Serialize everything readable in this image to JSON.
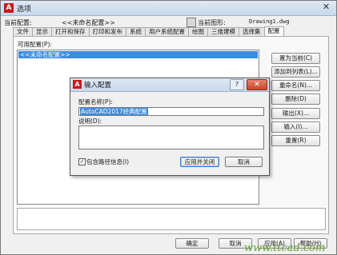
{
  "window": {
    "title": "选项",
    "app_icon": "A",
    "close": "✕"
  },
  "profile_row": {
    "current_profile_label": "当前配置:",
    "current_profile_value": "<<未命名配置>>",
    "current_drawing_label": "当前图形:",
    "current_drawing_value": "Drawing1.dwg"
  },
  "tabs": [
    "文件",
    "显示",
    "打开和保存",
    "打印和发布",
    "系统",
    "用户系统配置",
    "绘图",
    "三维建模",
    "选择集",
    "配置"
  ],
  "active_tab": "配置",
  "profiles": {
    "label": "可用配置(P):",
    "items": [
      "<<未命名配置>>"
    ]
  },
  "side_buttons": [
    "置为当前(C)",
    "添加到列表(L)...",
    "重命名(N)...",
    "删除(D)",
    "输出(X)...",
    "输入(I)...",
    "重置(R)"
  ],
  "bottom_buttons": [
    "确定",
    "取消",
    "应用(A)",
    "帮助(H)"
  ],
  "watermark": "www.ttcad.com",
  "dialog": {
    "title": "输入配置",
    "icon": "A",
    "help": "?",
    "close": "✕",
    "name_label": "配置名称(P):",
    "name_value": "AutoCAD2017经典配置",
    "desc_label": "说明(D):",
    "desc_value": "",
    "include_path_label": "包含路径信息(I)",
    "include_path_checked": "✓",
    "apply_close_label": "应用并关闭",
    "cancel_label": "取消"
  },
  "colors": {
    "accent_red": "#c8191e",
    "selection_blue": "#3b8bdf",
    "watermark_green": "#5f9e2a"
  }
}
